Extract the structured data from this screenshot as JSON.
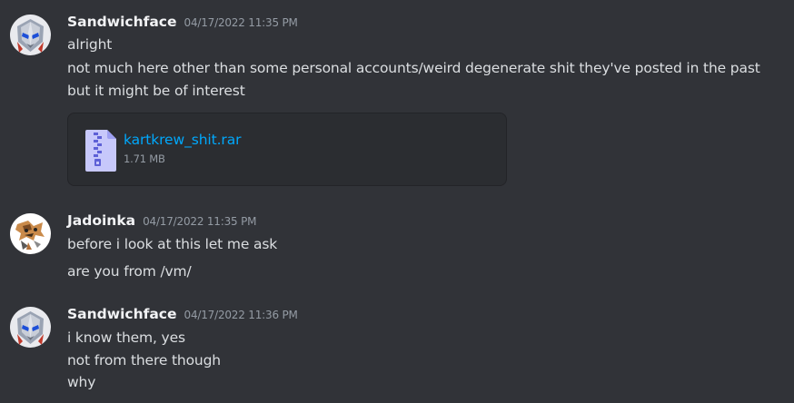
{
  "messages": [
    {
      "username": "Sandwichface",
      "timestamp": "04/17/2022 11:35 PM",
      "avatar_icon": "robot-mask-avatar",
      "lines": [
        "alright",
        "not much here other than some personal accounts/weird degenerate shit they've posted in the past",
        "but it might be of interest"
      ],
      "attachment": {
        "icon": "zip-archive-file-icon",
        "filename": "kartkrew_shit.rar",
        "size": "1.71 MB"
      }
    },
    {
      "username": "Jadoinka",
      "timestamp": "04/17/2022 11:35 PM",
      "avatar_icon": "cartoon-character-avatar",
      "lines": [
        "before i look at this let me ask",
        "are you from /vm/"
      ]
    },
    {
      "username": "Sandwichface",
      "timestamp": "04/17/2022 11:36 PM",
      "avatar_icon": "robot-mask-avatar",
      "lines": [
        "i know them, yes",
        "not from there though",
        "why"
      ]
    }
  ],
  "colors": {
    "background": "#313338",
    "username": "#f2f3f5",
    "timestamp": "#949ba4",
    "text": "#dbdee1",
    "link": "#00a8fc",
    "attachment_bg": "#2b2d31",
    "file_icon": "#c7c8fb"
  }
}
